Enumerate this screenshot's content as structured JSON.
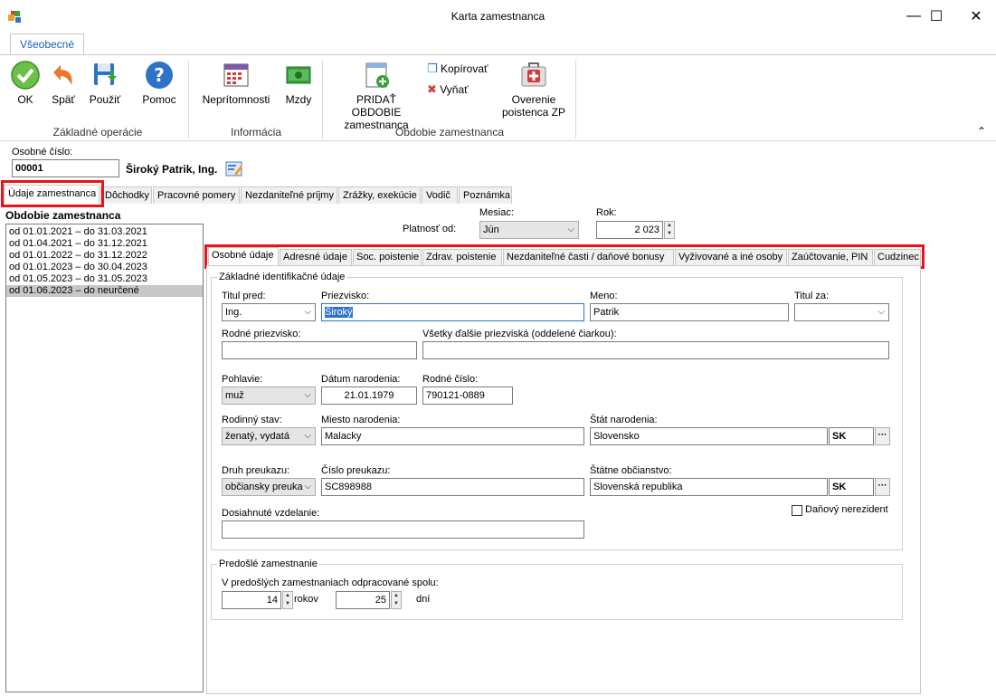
{
  "window": {
    "title": "Karta zamestnanca",
    "minimize_label": "—",
    "maximize_label": "☐",
    "close_label": "✕"
  },
  "ribbon": {
    "tab": "Všeobecné",
    "groups": [
      {
        "label": "Základné operácie",
        "buttons": [
          {
            "label": "OK",
            "icon": "check-icon"
          },
          {
            "label": "Späť",
            "icon": "undo-icon"
          },
          {
            "label": "Použiť",
            "icon": "save-icon"
          },
          {
            "label": "Pomoc",
            "icon": "help-icon"
          }
        ]
      },
      {
        "label": "Informácia",
        "buttons": [
          {
            "label": "Neprítomnosti",
            "icon": "calendar-icon"
          },
          {
            "label": "Mzdy",
            "icon": "money-icon"
          }
        ]
      },
      {
        "label": "Obdobie zamestnanca",
        "buttons": [
          {
            "label": "PRIDAŤ OBDOBIE",
            "label2": "zamestnanca",
            "icon": "add-period-icon"
          },
          {
            "label": "Kopírovať",
            "icon": "copy-icon"
          },
          {
            "label": "Vyňať",
            "icon": "cut-icon"
          },
          {
            "label": "Overenie",
            "label2": "poistenca ZP",
            "icon": "medkit-icon"
          }
        ]
      }
    ],
    "collapse_label": "⌃"
  },
  "header": {
    "osobne_cislo_label": "Osobné číslo:",
    "osobne_cislo": "00001",
    "employee_name": "Široký Patrik, Ing."
  },
  "main_tabs": [
    "Údaje zamestnanca",
    "Dôchodky",
    "Pracovné pomery",
    "Nezdaniteľné príjmy",
    "Zrážky, exekúcie",
    "Vodič",
    "Poznámka"
  ],
  "periods": {
    "title": "Obdobie zamestnanca",
    "items": [
      "od 01.01.2021 – do 31.03.2021",
      "od 01.04.2021 – do 31.12.2021",
      "od 01.01.2022 – do 31.12.2022",
      "od 01.01.2023 – do 30.04.2023",
      "od 01.05.2023 – do 31.05.2023",
      "od 01.06.2023 – do neurčené"
    ]
  },
  "validity": {
    "label": "Platnosť od:",
    "month_label": "Mesiac:",
    "month": "Jún",
    "year_label": "Rok:",
    "year": "2 023"
  },
  "sub_tabs": [
    "Osobné údaje",
    "Adresné údaje",
    "Soc. poistenie",
    "Zdrav. poistenie",
    "Nezdaniteľné časti  / daňové bonusy",
    "Vyživované a iné osoby",
    "Zaúčtovanie, PIN",
    "Cudzinec"
  ],
  "personal": {
    "group_title": "Základné identifikačné údaje",
    "titul_pred_label": "Titul pred:",
    "titul_pred": "Ing.",
    "priezvisko_label": "Priezvisko:",
    "priezvisko": "Široký",
    "meno_label": "Meno:",
    "meno": "Patrik",
    "titul_za_label": "Titul za:",
    "titul_za": "",
    "rodne_priezvisko_label": "Rodné priezvisko:",
    "rodne_priezvisko": "",
    "vsetky_priezviska_label": "Všetky ďalšie priezviská (oddelené čiarkou):",
    "vsetky_priezviska": "",
    "pohlavie_label": "Pohlavie:",
    "pohlavie": "muž",
    "datum_narodenia_label": "Dátum narodenia:",
    "datum_narodenia": "21.01.1979",
    "rodne_cislo_label": "Rodné číslo:",
    "rodne_cislo": "790121-0889",
    "rodinny_stav_label": "Rodinný stav:",
    "rodinny_stav": "ženatý, vydatá",
    "miesto_narodenia_label": "Miesto narodenia:",
    "miesto_narodenia": "Malacky",
    "stat_narodenia_label": "Štát narodenia:",
    "stat_narodenia": "Slovensko",
    "stat_narodenia_code": "SK",
    "druh_preukazu_label": "Druh preukazu:",
    "druh_preukazu": "občiansky preuka",
    "cislo_preukazu_label": "Číslo preukazu:",
    "cislo_preukazu": "SC898988",
    "statne_obcianstvo_label": "Štátne občianstvo:",
    "statne_obcianstvo": "Slovenská republika",
    "statne_obcianstvo_code": "SK",
    "dosiahnute_vzdelanie_label": "Dosiahnuté vzdelanie:",
    "dosiahnute_vzdelanie": "",
    "danovy_nerezident_label": "Daňový nerezident",
    "dots_label": "···"
  },
  "previous": {
    "group_title": "Predošlé zamestnanie",
    "label": "V predošlých zamestnaniach odpracované spolu:",
    "years": "14",
    "years_unit": "rokov",
    "days": "25",
    "days_unit": "dní"
  },
  "colors": {
    "highlight": "#e8141c",
    "accent": "#1e5fb4"
  }
}
